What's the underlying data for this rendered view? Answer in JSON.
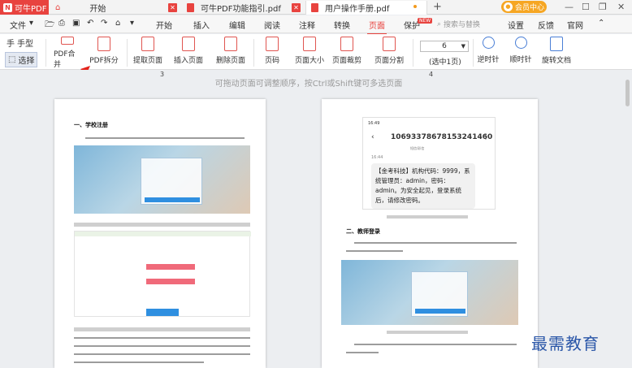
{
  "app": {
    "brand": "可牛PDF",
    "logo": "N"
  },
  "tabs": [
    {
      "label": "开始"
    },
    {
      "label": "可牛PDF功能指引.pdf"
    },
    {
      "label": "用户操作手册.pdf"
    }
  ],
  "vip": {
    "label": "会员中心"
  },
  "menu": {
    "file": "文件",
    "items": [
      "开始",
      "插入",
      "编辑",
      "阅读",
      "注释",
      "转换",
      "页面",
      "保护"
    ],
    "new_badge": "NEW",
    "search_placeholder": "搜索与替换",
    "right_items": [
      "设置",
      "反馈",
      "官网"
    ]
  },
  "tools": {
    "hand": "手",
    "hand_label": "手型",
    "select_label": "选择"
  },
  "toolbar": {
    "pdf_merge": "PDF合并",
    "pdf_split": "PDF拆分",
    "extract": "提取页面",
    "insert": "插入页面",
    "delete": "删除页面",
    "pagenum": "页码",
    "pagesize": "页面大小",
    "crop": "页面裁剪",
    "splitpage": "页面分割",
    "selection_value": "6",
    "selection_total": "(选中1页)",
    "rotate_ccw": "逆时针",
    "rotate_cw": "顺时针",
    "rotate_doc": "旋转文档"
  },
  "canvas": {
    "hint": "可拖动页面可调整顺序，按Ctrl或Shift键可多选页面",
    "page_numbers": [
      "3",
      "4"
    ]
  },
  "page3": {
    "heading": "一、学校注册"
  },
  "page4": {
    "phone_time": "16:49",
    "phone_number": "106933786781532414​60",
    "phone_sub": "短信/彩信",
    "phone_time2": "16:44",
    "sms": "【金考科技】机构代码：9999，系统管理员：admin，密码：admin。为安全起见，登录系统后，请修改密码。",
    "heading2": "二、教师登录"
  },
  "watermark": "最需教育"
}
